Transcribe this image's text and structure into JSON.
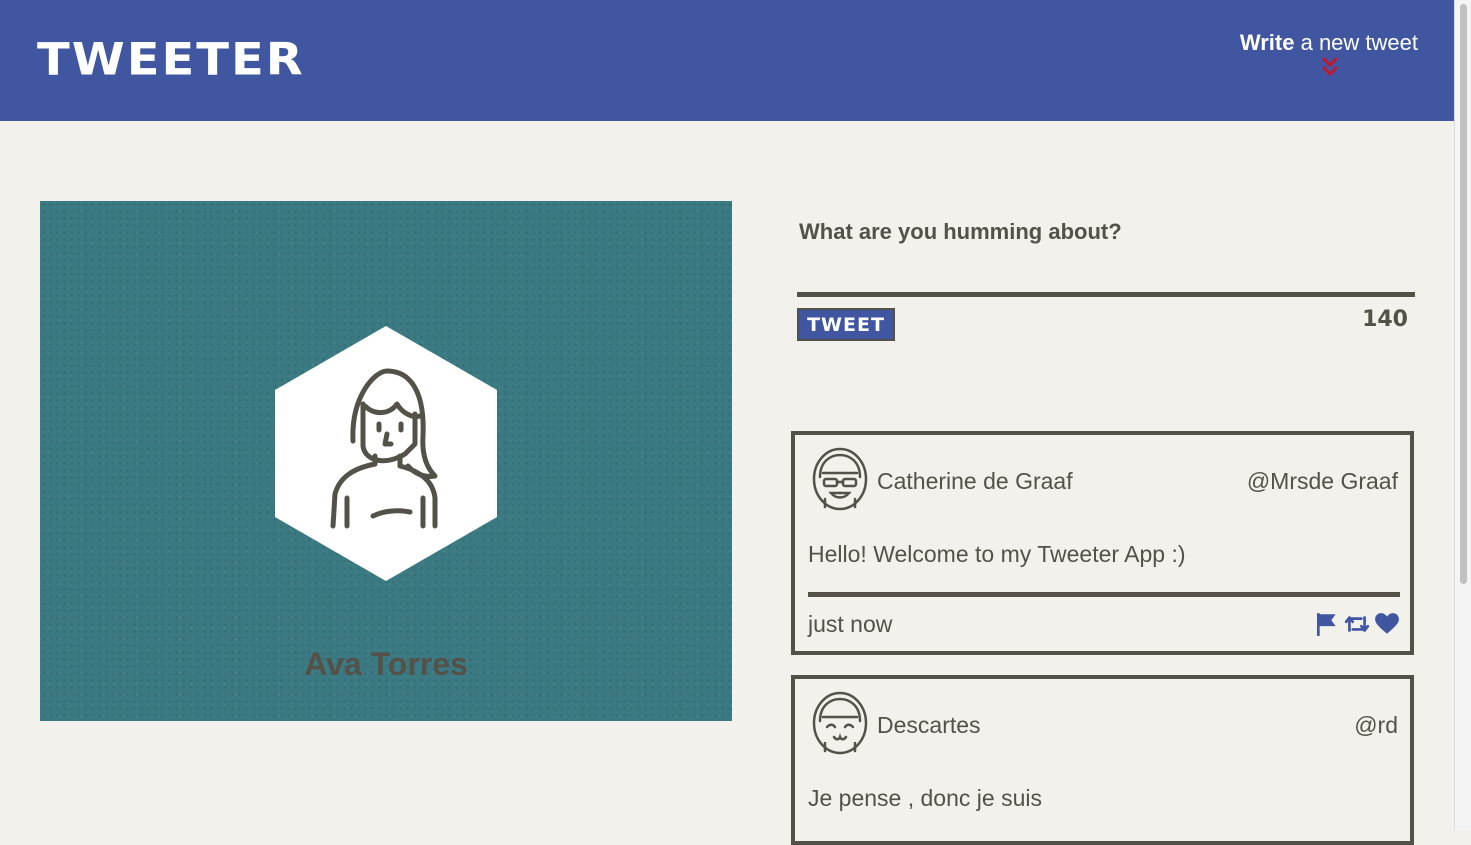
{
  "app": {
    "logo": "TWEETER",
    "accent_color": "#4056a1",
    "text_color": "#545149"
  },
  "nav": {
    "write_bold": "Write",
    "write_rest": " a new tweet",
    "chevron_icon": "double-chevron-down-icon"
  },
  "profile": {
    "name": "Ava Torres",
    "avatar_icon": "woman-avatar-icon"
  },
  "compose": {
    "label": "What are you humming about?",
    "button_label": "TWEET",
    "counter": "140"
  },
  "tweets": [
    {
      "name": "Catherine de Graaf",
      "handle": "@Mrsde Graaf",
      "text": "Hello! Welcome to my Tweeter App :)",
      "time": "just now",
      "actions": [
        "flag-icon",
        "retweet-icon",
        "heart-icon"
      ]
    },
    {
      "name": "Descartes",
      "handle": "@rd",
      "text": "Je pense , donc je suis"
    }
  ]
}
